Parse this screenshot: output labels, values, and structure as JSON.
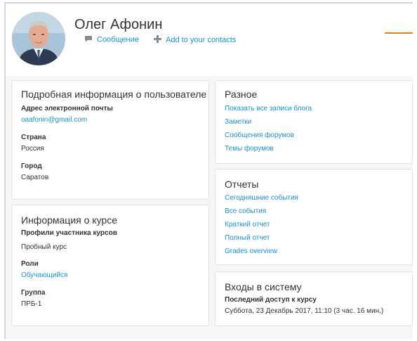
{
  "profile": {
    "name": "Олег Афонин",
    "message_label": "Сообщение",
    "add_contact_label": "Add to your contacts"
  },
  "user_details": {
    "title": "Подробная информация о пользователе",
    "email_label": "Адрес электронной почты",
    "email_value": "oaafonin@gmail.com",
    "country_label": "Страна",
    "country_value": "Россия",
    "city_label": "Город",
    "city_value": "Саратов"
  },
  "course_details": {
    "title": "Информация о курсе",
    "profiles_label": "Профили участника курсов",
    "profiles_value": "Пробный курс",
    "roles_label": "Роли",
    "roles_value": "Обучающийся",
    "group_label": "Группа",
    "group_value": "ПРБ-1"
  },
  "misc": {
    "title": "Разное",
    "links": [
      "Показать все записи блога",
      "Заметки",
      "Сообщения форумов",
      "Темы форумов"
    ]
  },
  "reports": {
    "title": "Отчеты",
    "links": [
      "Сегодняшние события",
      "Все события",
      "Краткий отчет",
      "Полный отчет",
      "Grades overview"
    ]
  },
  "logins": {
    "title": "Входы в систему",
    "last_access_label": "Последний доступ к курсу",
    "last_access_value": "Суббота, 23 Декабрь 2017, 11:10  (3 час. 16 мин.)"
  },
  "colors": {
    "link": "#1a8fd1",
    "accent": "#f07b1d",
    "background": "#f6f6f6"
  },
  "icons": [
    "user-avatar",
    "message-icon",
    "add-contact-icon"
  ]
}
